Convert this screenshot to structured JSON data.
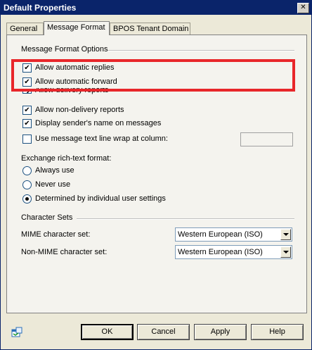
{
  "window": {
    "title": "Default Properties",
    "close_glyph": "✕"
  },
  "tabs": [
    {
      "label": "General"
    },
    {
      "label": "Message Format"
    },
    {
      "label": "BPOS Tenant Domain"
    }
  ],
  "message_format_options": {
    "group_label": "Message Format Options",
    "checkboxes": [
      {
        "label": "Allow automatic replies",
        "checked": true
      },
      {
        "label": "Allow automatic forward",
        "checked": true
      },
      {
        "label": "Allow delivery reports",
        "checked": true
      },
      {
        "label": "Allow non-delivery reports",
        "checked": true
      },
      {
        "label": "Display sender's name on messages",
        "checked": true
      },
      {
        "label": "Use message text line wrap at column:",
        "checked": false
      }
    ],
    "wrap_column_value": ""
  },
  "rich_text": {
    "label": "Exchange rich-text format:",
    "options": [
      {
        "label": "Always use",
        "selected": false
      },
      {
        "label": "Never use",
        "selected": false
      },
      {
        "label": "Determined by individual user settings",
        "selected": true
      }
    ]
  },
  "character_sets": {
    "group_label": "Character Sets",
    "mime_label": "MIME character set:",
    "mime_value": "Western European (ISO)",
    "non_mime_label": "Non-MIME character set:",
    "non_mime_value": "Western European (ISO)"
  },
  "buttons": {
    "ok": "OK",
    "cancel": "Cancel",
    "apply": "Apply",
    "help": "Help"
  },
  "highlight_color": "#e8262a"
}
